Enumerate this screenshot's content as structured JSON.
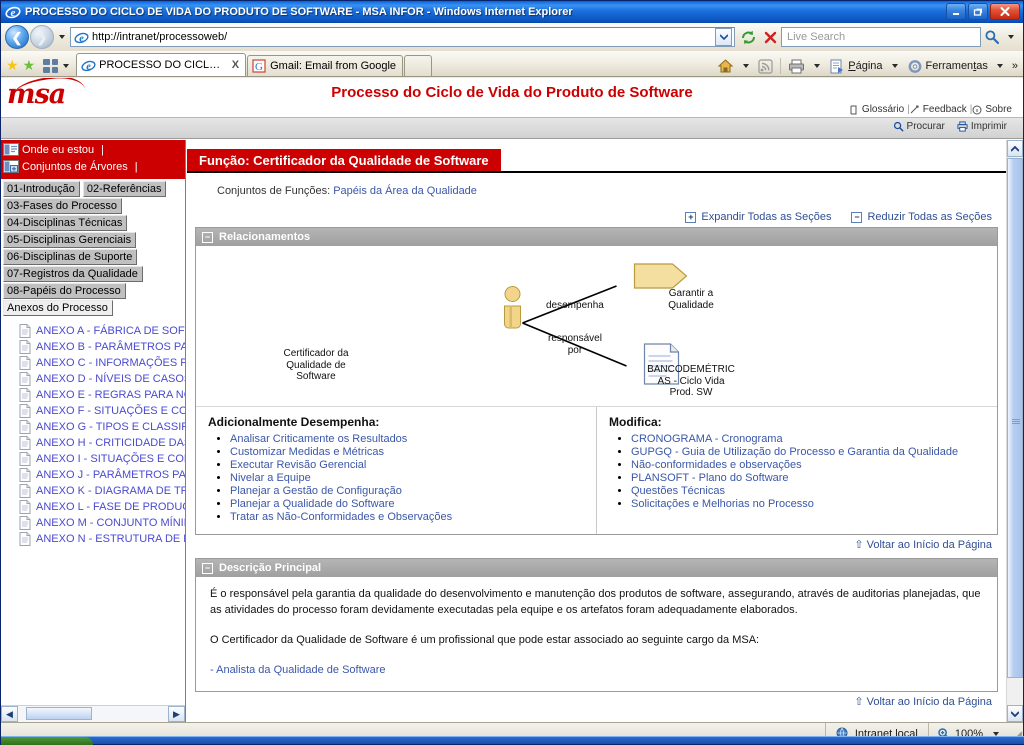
{
  "browser": {
    "window_title": "PROCESSO DO CICLO DE VIDA DO PRODUTO DE SOFTWARE - MSA INFOR - Windows Internet Explorer",
    "url": "http://intranet/processoweb/",
    "search_placeholder": "Live Search",
    "minimize_label": "Minimizar",
    "restore_label": "Restaurar",
    "close_label": "Fechar",
    "tabs": [
      {
        "label": "PROCESSO DO CICLO DE...",
        "close": "X"
      },
      {
        "label": "Gmail: Email from Google"
      }
    ],
    "commands": [
      {
        "label": "Página",
        "underline": "P"
      },
      {
        "label": "Ferramentas",
        "underline": "t"
      }
    ],
    "overflow": "»"
  },
  "status": {
    "zone": "Intranet local",
    "zoom": "100%"
  },
  "site": {
    "logo": "msa",
    "title": "Processo do Ciclo de Vida do Produto de Software",
    "header_links": [
      "Glossário",
      "Feedback",
      "Sobre"
    ],
    "toolbar_links": [
      "Procurar",
      "Imprimir"
    ]
  },
  "tree": {
    "top_links": [
      "Onde eu estou",
      "Conjuntos de Árvores"
    ],
    "tabs_row1": [
      "01-Introdução",
      "02-Referências"
    ],
    "tabs": [
      "03-Fases do Processo",
      "04-Disciplinas Técnicas",
      "05-Disciplinas Gerenciais",
      "06-Disciplinas de Suporte",
      "07-Registros da Qualidade",
      "08-Papéis do Processo"
    ],
    "tab_current": "Anexos do Processo",
    "items": [
      "ANEXO A - FÁBRICA DE SOFT",
      "ANEXO B - PARÂMETROS PAI",
      "ANEXO C - INFORMAÇÕES PÁ",
      "ANEXO D - NÍVEIS DE CASOS",
      "ANEXO E - REGRAS PARA NC",
      "ANEXO F - SITUAÇÕES E COI",
      "ANEXO G - TIPOS E CLASSIFI",
      "ANEXO H - CRITICIDADE DAS",
      "ANEXO I - SITUAÇÕES E COM",
      "ANEXO J - PARÂMETROS PAF",
      "ANEXO K - DIAGRAMA DE TRÁ",
      "ANEXO L - FASE DE PRODUÇ",
      "ANEXO M - CONJUNTO MÍNIM",
      "ANEXO N - ESTRUTURA DE F"
    ]
  },
  "content": {
    "page_title": "Função: Certificador da Qualidade de Software",
    "subinfo_label": "Conjuntos de Funções:",
    "subinfo_link": "Papéis da Área da Qualidade",
    "expand_all": "Expandir Todas as Seções",
    "collapse_all": "Reduzir Todas as Seções",
    "section_relations_title": "Relacionamentos",
    "section_description_title": "Descrição Principal",
    "back_to_top": "Voltar ao Início da Página",
    "diagram": {
      "role_node": "Certificador da\nQualidade de\nSoftware",
      "role_node_l1": "Certificador da",
      "role_node_l2": "Qualidade de",
      "role_node_l3": "Software",
      "edge1": "desempenha",
      "edge2_l1": "responsável",
      "edge2_l2": "por",
      "target1_l1": "Garantir a",
      "target1_l2": "Qualidade",
      "target2_l1": "BANCODEMÉTRIC",
      "target2_l2": "AS - Ciclo Vida",
      "target2_l3": "Prod. SW"
    },
    "col_left_title": "Adicionalmente Desempenha:",
    "col_left_items": [
      "Analisar Criticamente os Resultados",
      "Customizar Medidas e Métricas",
      "Executar Revisão Gerencial",
      "Nivelar a Equipe",
      "Planejar a Gestão de Configuração",
      "Planejar a Qualidade do Software",
      "Tratar as Não-Conformidades e Observações"
    ],
    "col_right_title": "Modifica:",
    "col_right_items": [
      "CRONOGRAMA - Cronograma",
      "GUPGQ - Guia de Utilização do Processo e Garantia da Qualidade",
      "Não-conformidades e observações",
      "PLANSOFT - Plano do Software",
      "Questões Técnicas",
      "Solicitações e Melhorias no Processo"
    ],
    "desc_p1": "É o responsável pela garantia da qualidade do desenvolvimento e manutenção dos produtos de software, assegurando, através de auditorias planejadas, que as atividades do processo foram devidamente executadas pela equipe e os artefatos foram adequadamente elaborados.",
    "desc_p2": "O Certificador da Qualidade de Software é um profissional que pode estar associado ao seguinte cargo da MSA:",
    "desc_link": "- Analista da Qualidade de Software"
  },
  "colors": {
    "brand_red": "#cc0000",
    "link_blue": "#3b57a8",
    "tree_link": "#4a4ad0",
    "section_gray": "#a6a6a6"
  }
}
